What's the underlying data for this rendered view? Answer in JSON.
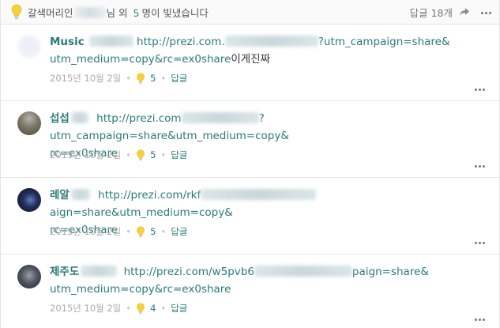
{
  "header": {
    "likers_prefix": "갈색머리인",
    "likers_middle": "님 외",
    "count": "5",
    "likers_suffix": "명이 빛냈습니다",
    "reply_count_label": "답글 18개",
    "icons": [
      "lightbulb-icon",
      "share-icon",
      "more-icon"
    ]
  },
  "comments": [
    {
      "author": "Music",
      "line1_a": "http://prezi.com.",
      "line1_b": "?utm_campaign=share&",
      "line2": "utm_medium=copy&rc=ex0share",
      "line2_extra": "이게진짜",
      "date": "2015년 10월 2일",
      "likes": "5",
      "reply": "답글"
    },
    {
      "author": "섭섭",
      "line1_a": "http://prezi.com",
      "line1_b": "?utm_campaign=share&utm_medium=copy&",
      "line2": "rc=ex0share",
      "line2_extra": "",
      "date": "2015년 10월 2일",
      "likes": "5",
      "reply": "답글"
    },
    {
      "author": "레알",
      "line1_a": "http://prezi.com/rkf",
      "line1_b": "aign=share&utm_medium=copy&",
      "line2": "rc=ex0share",
      "line2_extra": "",
      "date": "2015년 10월 2일",
      "likes": "5",
      "reply": "답글"
    },
    {
      "author": "제주도",
      "line1_a": "http://prezi.com/w5pvb6",
      "line1_b": "paign=share&",
      "line2": "utm_medium=copy&rc=ex0share",
      "line2_extra": "",
      "date": "2015년 10월 2일",
      "likes": "4",
      "reply": "답글"
    }
  ]
}
